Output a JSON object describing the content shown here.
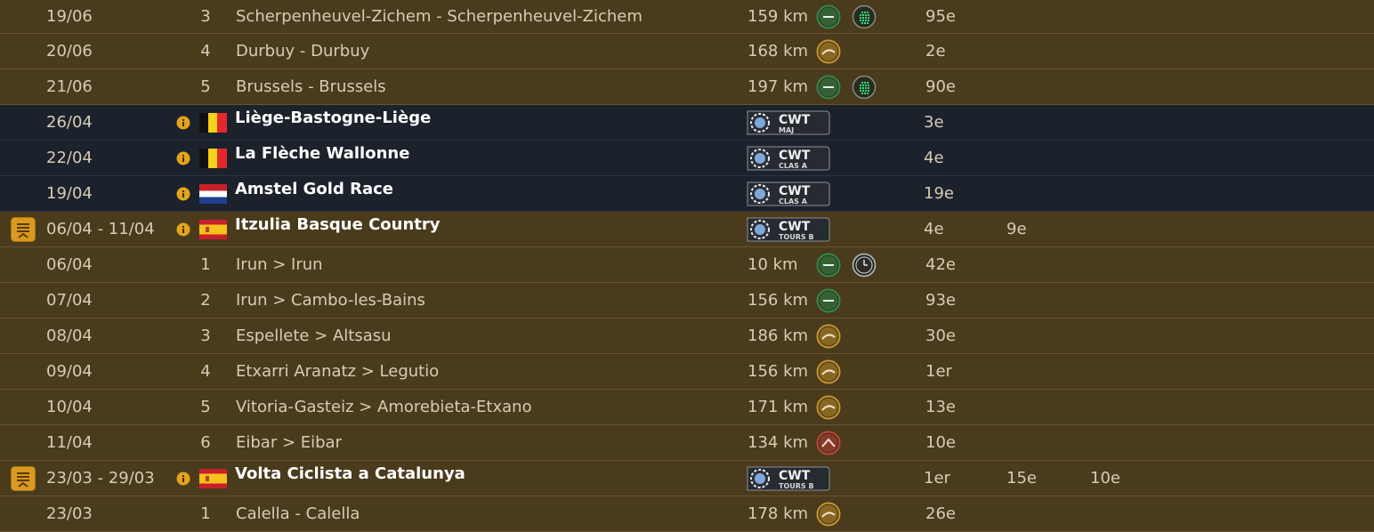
{
  "rows": [
    {
      "kind": "stage",
      "date": "19/06",
      "num": "3",
      "title": "Scherpenheuvel-Zichem - Scherpenheuvel-Zichem",
      "dist": "159 km",
      "profile": "flat",
      "type_icon": "sprint",
      "r1": "95e"
    },
    {
      "kind": "stage",
      "date": "20/06",
      "num": "4",
      "title": "Durbuy - Durbuy",
      "dist": "168 km",
      "profile": "hilly",
      "r1": "2e"
    },
    {
      "kind": "stage",
      "date": "21/06",
      "num": "5",
      "title": "Brussels - Brussels",
      "dist": "197 km",
      "profile": "flat",
      "type_icon": "sprint",
      "r1": "90e"
    },
    {
      "kind": "race",
      "date": "26/04",
      "name": "Liège-Bastogne-Liège",
      "flag": "belgium",
      "badge_top": "CWT",
      "badge_sub": "MAJ",
      "r1": "3e"
    },
    {
      "kind": "race",
      "date": "22/04",
      "name": "La Flèche Wallonne",
      "flag": "belgium",
      "badge_top": "CWT",
      "badge_sub": "CLAS A",
      "r1": "4e"
    },
    {
      "kind": "race",
      "date": "19/04",
      "name": "Amstel Gold Race",
      "flag": "netherlands",
      "badge_top": "CWT",
      "badge_sub": "CLAS A",
      "r1": "19e"
    },
    {
      "kind": "tour",
      "date": "06/04 - 11/04",
      "name": "Itzulia Basque Country",
      "flag": "spain",
      "badge_top": "CWT",
      "badge_sub": "TOURS B",
      "r1": "4e",
      "r2": "9e"
    },
    {
      "kind": "stage",
      "date": "06/04",
      "num": "1",
      "title": "Irun > Irun",
      "dist": "10 km",
      "profile": "flat",
      "type_icon": "clock",
      "r1": "42e"
    },
    {
      "kind": "stage",
      "date": "07/04",
      "num": "2",
      "title": "Irun > Cambo-les-Bains",
      "dist": "156 km",
      "profile": "flat",
      "r1": "93e"
    },
    {
      "kind": "stage",
      "date": "08/04",
      "num": "3",
      "title": "Espellete > Altsasu",
      "dist": "186 km",
      "profile": "hilly",
      "r1": "30e"
    },
    {
      "kind": "stage",
      "date": "09/04",
      "num": "4",
      "title": "Etxarri Aranatz > Legutio",
      "dist": "156 km",
      "profile": "hilly",
      "r1": "1er"
    },
    {
      "kind": "stage",
      "date": "10/04",
      "num": "5",
      "title": "Vitoria-Gasteiz > Amorebieta-Etxano",
      "dist": "171 km",
      "profile": "hilly",
      "r1": "13e"
    },
    {
      "kind": "stage",
      "date": "11/04",
      "num": "6",
      "title": "Eibar > Eibar",
      "dist": "134 km",
      "profile": "mountain",
      "r1": "10e"
    },
    {
      "kind": "tour",
      "date": "23/03 - 29/03",
      "name": "Volta Ciclista a Catalunya",
      "flag": "spain",
      "badge_top": "CWT",
      "badge_sub": "TOURS B",
      "r1": "1er",
      "r2": "15e",
      "r3": "10e"
    },
    {
      "kind": "stage",
      "date": "23/03",
      "num": "1",
      "title": "Calella - Calella",
      "dist": "178 km",
      "profile": "hilly",
      "r1": "26e"
    }
  ],
  "colors": {
    "flat": "#2f8a4e",
    "hilly": "#c8962e",
    "mountain": "#c0453a",
    "sprint": "#2ee07a",
    "info": "#e3a41b"
  }
}
